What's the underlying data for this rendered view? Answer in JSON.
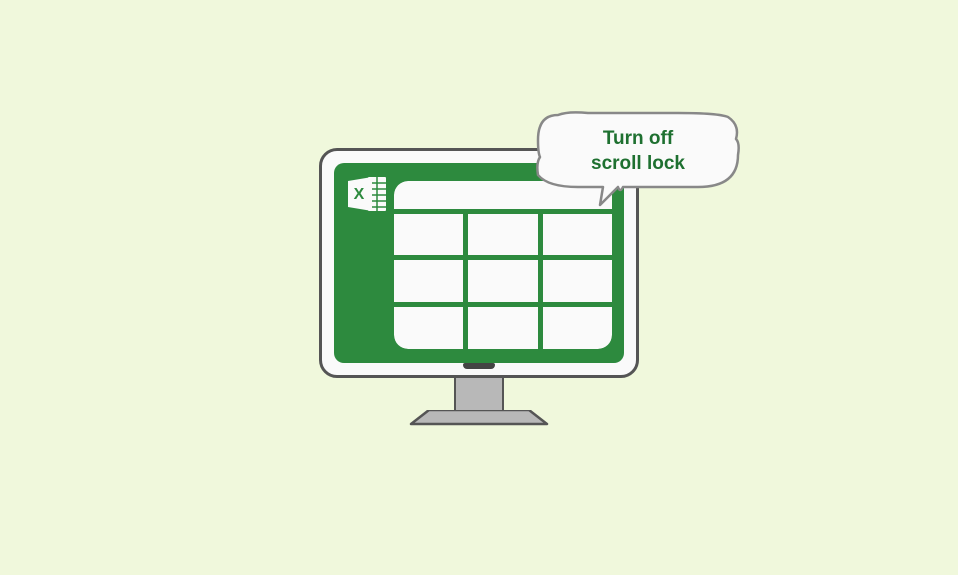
{
  "speech_bubble": {
    "line1": "Turn off",
    "line2": "scroll lock"
  },
  "icon": {
    "name": "excel-icon",
    "letter": "X"
  },
  "colors": {
    "background": "#f0f8dc",
    "screen_green": "#2d8a3e",
    "text_green": "#1e7030",
    "monitor_stroke": "#555",
    "stand_fill": "#b8b8b8"
  }
}
